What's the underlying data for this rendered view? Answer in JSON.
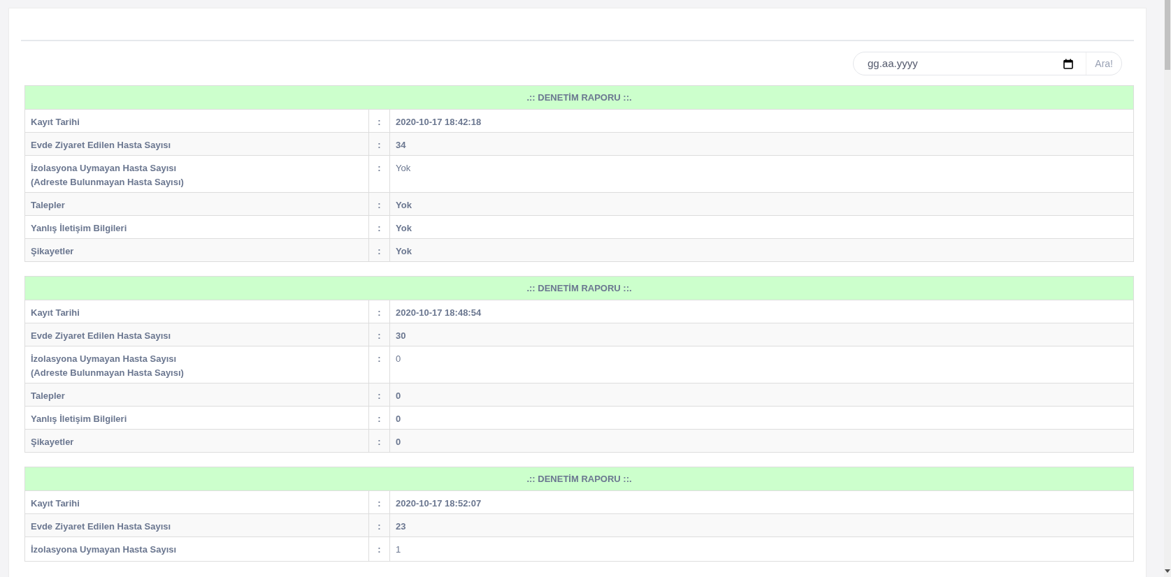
{
  "search": {
    "placeholder": "gg.aa.yyyy",
    "button": "Ara!"
  },
  "reports": [
    {
      "title": ".:: DENETİM RAPORU ::.",
      "rows": [
        {
          "kind": "plain",
          "label": "Kayıt Tarihi",
          "sep": ":",
          "value": "2020-10-17 18:42:18"
        },
        {
          "kind": "plain",
          "label": "Evde Ziyaret Edilen Hasta Sayısı",
          "sep": ":",
          "value": "34"
        },
        {
          "kind": "note",
          "label": "İzolasyona Uymayan Hasta Sayısı",
          "sublabel": "(Adreste Bulunmayan Hasta Sayısı)",
          "sep": ":",
          "value": "Yok"
        },
        {
          "kind": "plain",
          "label": "Talepler",
          "sep": ":",
          "value": "Yok"
        },
        {
          "kind": "plain",
          "label": "Yanlış İletişim Bilgileri",
          "sep": ":",
          "value": "Yok"
        },
        {
          "kind": "plain",
          "label": "Şikayetler",
          "sep": ":",
          "value": "Yok"
        }
      ]
    },
    {
      "title": ".:: DENETİM RAPORU ::.",
      "rows": [
        {
          "kind": "plain",
          "label": "Kayıt Tarihi",
          "sep": ":",
          "value": "2020-10-17 18:48:54"
        },
        {
          "kind": "plain",
          "label": "Evde Ziyaret Edilen Hasta Sayısı",
          "sep": ":",
          "value": "30"
        },
        {
          "kind": "note",
          "label": "İzolasyona Uymayan Hasta Sayısı",
          "sublabel": "(Adreste Bulunmayan Hasta Sayısı)",
          "sep": ":",
          "value": "0"
        },
        {
          "kind": "plain",
          "label": "Talepler",
          "sep": ":",
          "value": "0"
        },
        {
          "kind": "plain",
          "label": "Yanlış İletişim Bilgileri",
          "sep": ":",
          "value": "0"
        },
        {
          "kind": "plain",
          "label": "Şikayetler",
          "sep": ":",
          "value": "0"
        }
      ]
    },
    {
      "title": ".:: DENETİM RAPORU ::.",
      "rows": [
        {
          "kind": "plain",
          "label": "Kayıt Tarihi",
          "sep": ":",
          "value": "2020-10-17 18:52:07"
        },
        {
          "kind": "plain",
          "label": "Evde Ziyaret Edilen Hasta Sayısı",
          "sep": ":",
          "value": "23"
        },
        {
          "kind": "note",
          "label": "İzolasyona Uymayan Hasta Sayısı",
          "sep": ":",
          "value": "1"
        }
      ]
    }
  ]
}
